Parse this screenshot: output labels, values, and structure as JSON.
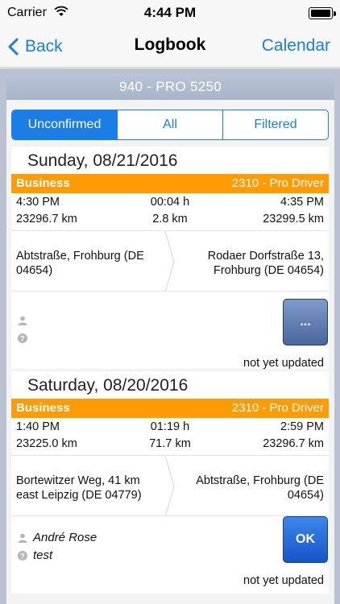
{
  "status_bar": {
    "carrier": "Carrier",
    "time": "4:44 PM"
  },
  "nav": {
    "back_label": "Back",
    "title": "Logbook",
    "right_label": "Calendar"
  },
  "panel": {
    "header": "940 - PRO 5250"
  },
  "segments": [
    {
      "label": "Unconfirmed",
      "active": true
    },
    {
      "label": "All",
      "active": false
    },
    {
      "label": "Filtered",
      "active": false
    }
  ],
  "trips": [
    {
      "date": "Sunday, 08/21/2016",
      "category": "Business",
      "driver": "2310 - Pro Driver",
      "start_time": "4:30 PM",
      "duration": "00:04 h",
      "end_time": "4:35 PM",
      "start_km": "23296.7 km",
      "distance": "2.8 km",
      "end_km": "23299.5 km",
      "from": "Abtstraße, Frohburg (DE 04654)",
      "to": "Rodaer Dorfstraße 13, Frohburg (DE 04654)",
      "person": "",
      "note": "",
      "button_label": "...",
      "status": "not yet updated"
    },
    {
      "date": "Saturday, 08/20/2016",
      "category": "Business",
      "driver": "2310 - Pro Driver",
      "start_time": "1:40 PM",
      "duration": "01:19 h",
      "end_time": "2:59 PM",
      "start_km": "23225.0 km",
      "distance": "71.7 km",
      "end_km": "23296.7 km",
      "from": "Bortewitzer Weg, 41 km east Leipzig (DE 04779)",
      "to": "Abtstraße, Frohburg (DE 04654)",
      "person": "André Rose",
      "note": "test",
      "button_label": "OK",
      "status": "not yet updated"
    }
  ],
  "colors": {
    "accent": "#1a7ee6",
    "category_bar": "#ff9b05",
    "panel_background": "#b8c2d2"
  },
  "icons": [
    "wifi-icon",
    "battery-icon",
    "chevron-left-icon",
    "route-arrow-icon",
    "person-icon",
    "help-icon"
  ]
}
